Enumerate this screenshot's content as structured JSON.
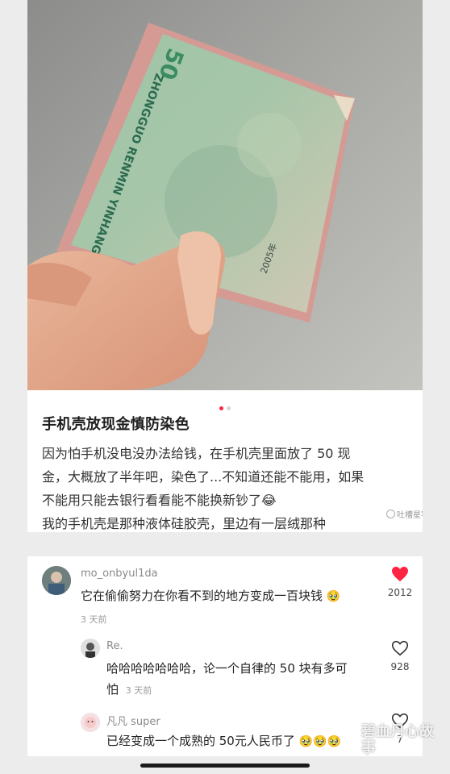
{
  "post": {
    "title": "手机壳放现金慎防染色",
    "body_line1": "因为怕手机没电没办法给钱，在手机壳里面放了 50 现",
    "body_line2": "金，大概放了半年吧，染色了...不知道还能不能用，如果",
    "body_line3": "不能用只能去银行看看能不能换新钞了😂",
    "body_line4": "我的手机壳是那种液体硅胶壳，里边有一层绒那种",
    "watermark": "吐槽星客"
  },
  "banknote": {
    "denomination": "50",
    "text_pinyin": "ZHONGGUO RENMIN YINHANG",
    "year": "2005年"
  },
  "comments": [
    {
      "username": "mo_onbyul1da",
      "text": "它在偷偷努力在你看不到的地方变成一百块钱",
      "emoji": "🥹",
      "time": "3 天前",
      "likes": "2012",
      "liked": true,
      "icon": "heart-filled-icon"
    },
    {
      "username": "Re.",
      "text_line1": "哈哈哈哈哈哈哈，论一个自律的 50 块有多可",
      "text_line2": "怕",
      "time": "3 天前",
      "likes": "928",
      "liked": false,
      "icon": "heart-outline-icon"
    },
    {
      "username": "凡凡 super",
      "text": "已经变成一个成熟的 50元人民币了",
      "emoji": "🥹🥹🥹",
      "likes": "7",
      "liked": false,
      "icon": "heart-outline-icon"
    }
  ],
  "corner_watermark": "碧血丹心故事",
  "colors": {
    "accent": "#ff2442",
    "liked_heart": "#ff2442"
  }
}
